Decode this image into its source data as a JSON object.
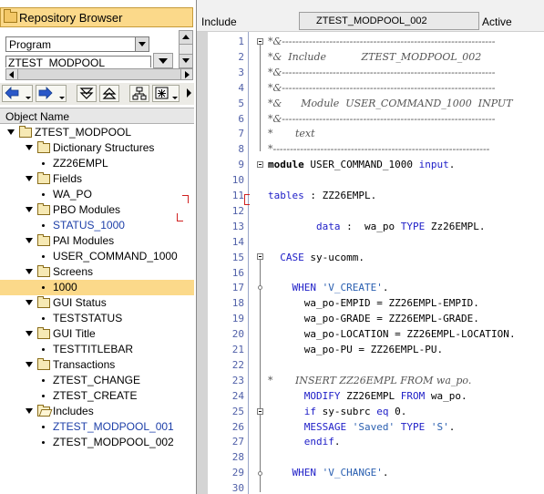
{
  "navigator": {
    "title": "Repository Browser",
    "object_type": "Program",
    "object_name": "ZTEST_MODPOOL",
    "column_header": "Object Name",
    "tree": [
      {
        "level": 0,
        "kind": "folder",
        "label": "ZTEST_MODPOOL",
        "expanded": true
      },
      {
        "level": 1,
        "kind": "folder",
        "label": "Dictionary Structures",
        "expanded": true
      },
      {
        "level": 2,
        "kind": "leaf",
        "label": "ZZ26EMPL"
      },
      {
        "level": 1,
        "kind": "folder",
        "label": "Fields",
        "expanded": true
      },
      {
        "level": 2,
        "kind": "leaf",
        "label": "WA_PO"
      },
      {
        "level": 1,
        "kind": "folder",
        "label": "PBO Modules",
        "expanded": true
      },
      {
        "level": 2,
        "kind": "leaf",
        "label": "STATUS_1000",
        "blue": true
      },
      {
        "level": 1,
        "kind": "folder",
        "label": "PAI Modules",
        "expanded": true
      },
      {
        "level": 2,
        "kind": "leaf",
        "label": "USER_COMMAND_1000"
      },
      {
        "level": 1,
        "kind": "folder",
        "label": "Screens",
        "expanded": true
      },
      {
        "level": 2,
        "kind": "leaf",
        "label": "1000",
        "selected": true
      },
      {
        "level": 1,
        "kind": "folder",
        "label": "GUI Status",
        "expanded": true
      },
      {
        "level": 2,
        "kind": "leaf",
        "label": "TESTSTATUS"
      },
      {
        "level": 1,
        "kind": "folder",
        "label": "GUI Title",
        "expanded": true
      },
      {
        "level": 2,
        "kind": "leaf",
        "label": "TESTTITLEBAR"
      },
      {
        "level": 1,
        "kind": "folder",
        "label": "Transactions",
        "expanded": true
      },
      {
        "level": 2,
        "kind": "leaf",
        "label": "ZTEST_CHANGE"
      },
      {
        "level": 2,
        "kind": "leaf",
        "label": "ZTEST_CREATE"
      },
      {
        "level": 1,
        "kind": "folder-open",
        "label": "Includes",
        "expanded": true
      },
      {
        "level": 2,
        "kind": "leaf",
        "label": "ZTEST_MODPOOL_001",
        "blue": true
      },
      {
        "level": 2,
        "kind": "leaf",
        "label": "ZTEST_MODPOOL_002"
      }
    ]
  },
  "editor": {
    "object_kind": "Include",
    "object_name": "ZTEST_MODPOOL_002",
    "status": "Active",
    "lines": [
      {
        "n": "1",
        "text": "*&---------------------------------------------------------------"
      },
      {
        "n": "2",
        "text": "*&  Include           ZTEST_MODPOOL_002"
      },
      {
        "n": "3",
        "text": "*&---------------------------------------------------------------"
      },
      {
        "n": "4",
        "text": "*&---------------------------------------------------------------"
      },
      {
        "n": "5",
        "text": "*&      Module  USER_COMMAND_1000  INPUT"
      },
      {
        "n": "6",
        "text": "*&---------------------------------------------------------------"
      },
      {
        "n": "7",
        "text": "*       text"
      },
      {
        "n": "8",
        "text": "*----------------------------------------------------------------"
      },
      {
        "n": "9",
        "text": "module USER_COMMAND_1000 input."
      },
      {
        "n": "10",
        "text": ""
      },
      {
        "n": "11",
        "text": "tables : ZZ26EMPL."
      },
      {
        "n": "12",
        "text": ""
      },
      {
        "n": "13",
        "text": "        data :  wa_po TYPE Zz26EMPL."
      },
      {
        "n": "14",
        "text": ""
      },
      {
        "n": "15",
        "text": "  CASE sy-ucomm."
      },
      {
        "n": "16",
        "text": ""
      },
      {
        "n": "17",
        "text": "    WHEN 'V_CREATE'."
      },
      {
        "n": "18",
        "text": "      wa_po-EMPID = ZZ26EMPL-EMPID."
      },
      {
        "n": "19",
        "text": "      wa_po-GRADE = ZZ26EMPL-GRADE."
      },
      {
        "n": "20",
        "text": "      wa_po-LOCATION = ZZ26EMPL-LOCATION."
      },
      {
        "n": "21",
        "text": "      wa_po-PU = ZZ26EMPL-PU."
      },
      {
        "n": "22",
        "text": ""
      },
      {
        "n": "23",
        "text": "*       INSERT ZZ26EMPL FROM wa_po."
      },
      {
        "n": "24",
        "text": "      MODIFY ZZ26EMPL FROM wa_po."
      },
      {
        "n": "25",
        "text": "      if sy-subrc eq 0."
      },
      {
        "n": "26",
        "text": "      MESSAGE 'Saved' TYPE 'S'."
      },
      {
        "n": "27",
        "text": "      endif."
      },
      {
        "n": "28",
        "text": ""
      },
      {
        "n": "29",
        "text": "    WHEN 'V_CHANGE'."
      },
      {
        "n": "30",
        "text": ""
      }
    ]
  },
  "colors": {
    "selection": "#fbd98a",
    "keyword": "#2020c8",
    "line_number": "#5060a8",
    "blue_link": "#1d3fa8"
  }
}
